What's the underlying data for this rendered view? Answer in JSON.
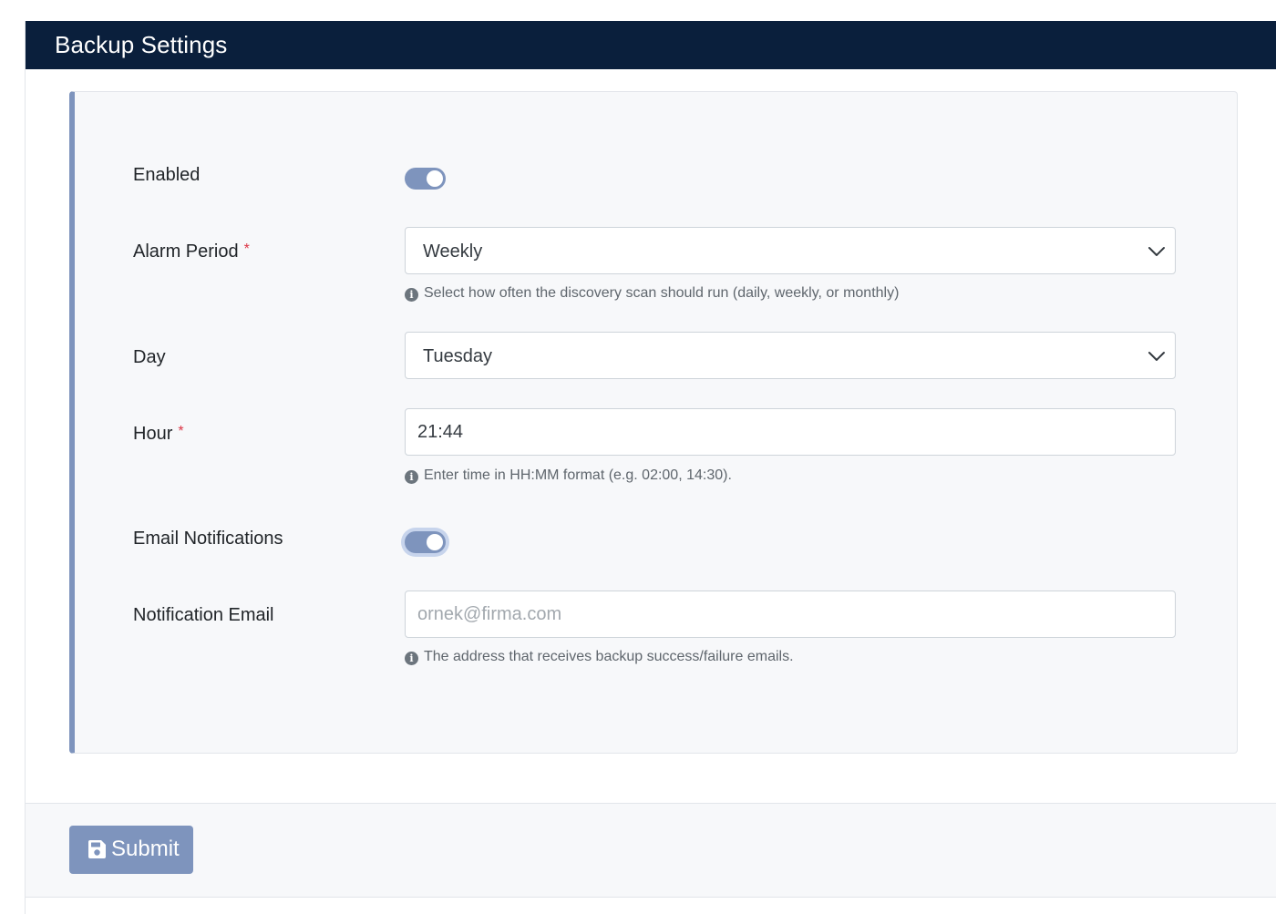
{
  "header": {
    "title": "Backup Settings"
  },
  "colors": {
    "header_bg": "#0a1f3c",
    "accent": "#7e94bd",
    "required": "#dc3545",
    "panel_bg": "#f7f8fa"
  },
  "form": {
    "enabled": {
      "label": "Enabled",
      "checked": true
    },
    "alarm_period": {
      "label": "Alarm Period",
      "required_mark": "*",
      "value": "Weekly",
      "help": "Select how often the discovery scan should run (daily, weekly, or monthly)",
      "help_icon": "info-circle-icon"
    },
    "day": {
      "label": "Day",
      "value": "Tuesday"
    },
    "hour": {
      "label": "Hour",
      "required_mark": "*",
      "value": "21:44",
      "help": "Enter time in HH:MM format (e.g. 02:00, 14:30).",
      "help_icon": "info-circle-icon"
    },
    "email_notifications": {
      "label": "Email Notifications",
      "checked": true
    },
    "notification_email": {
      "label": "Notification Email",
      "value": "",
      "placeholder": "ornek@firma.com",
      "help": "The address that receives backup success/failure emails.",
      "help_icon": "info-circle-icon"
    }
  },
  "footer": {
    "submit_label": "Submit",
    "submit_icon": "floppy-disk-icon"
  }
}
